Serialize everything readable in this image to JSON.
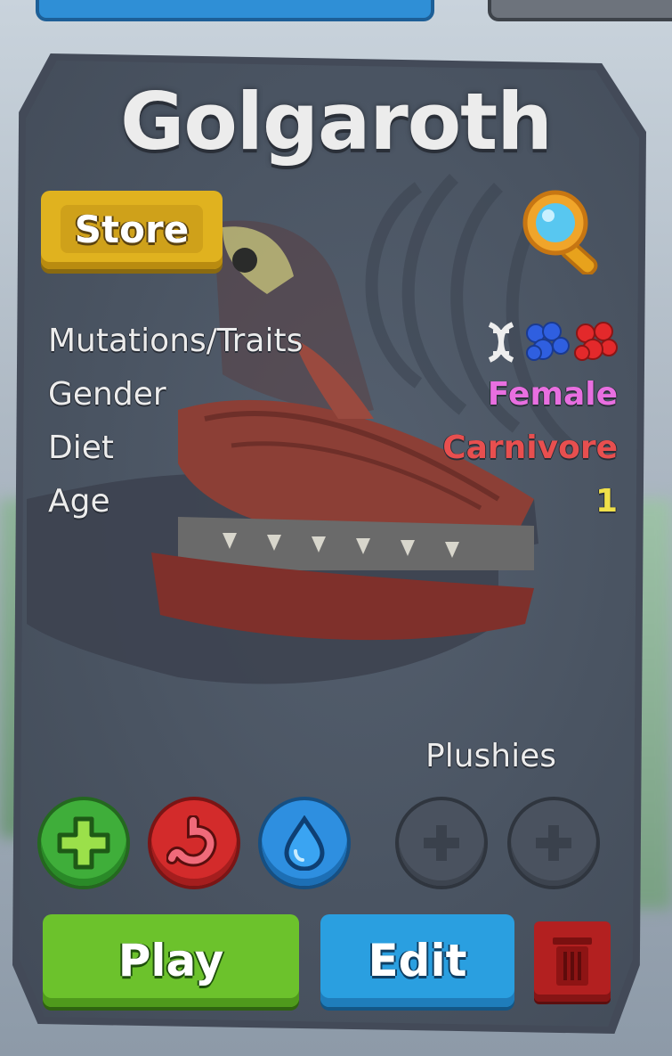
{
  "creature": {
    "name": "Golgaroth"
  },
  "buttons": {
    "store_label": "Store",
    "play_label": "Play",
    "edit_label": "Edit"
  },
  "stats": {
    "mutations_label": "Mutations/Traits",
    "gender_label": "Gender",
    "gender_value": "Female",
    "diet_label": "Diet",
    "diet_value": "Carnivore",
    "age_label": "Age",
    "age_value": "1"
  },
  "plushies": {
    "label": "Plushies"
  },
  "icons": {
    "search": "magnifier-icon",
    "dna": "dna-icon",
    "blue_trait": "blue-cluster-icon",
    "red_trait": "red-cluster-icon",
    "heal": "plus-icon",
    "food": "stomach-icon",
    "water": "water-drop-icon",
    "plush_slot": "plus-icon",
    "delete": "trash-icon"
  },
  "colors": {
    "female": "#e86fe0",
    "carnivore": "#e84f4f",
    "age": "#f0e04a"
  }
}
